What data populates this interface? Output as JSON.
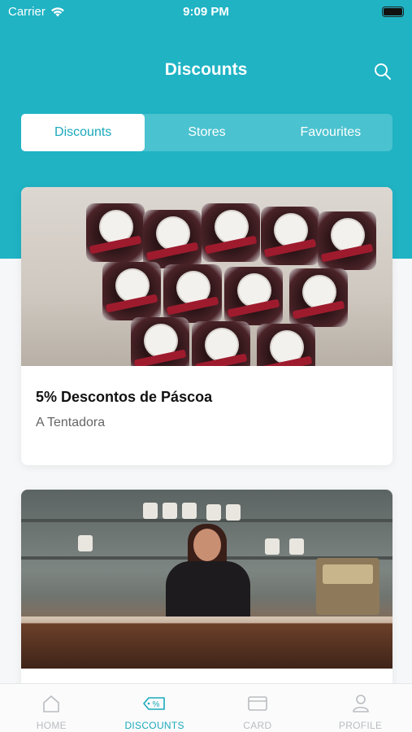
{
  "status_bar": {
    "carrier": "Carrier",
    "time": "9:09 PM"
  },
  "header": {
    "title": "Discounts",
    "search_icon": "search-icon"
  },
  "segments": [
    {
      "label": "Discounts",
      "active": true
    },
    {
      "label": "Stores",
      "active": false
    },
    {
      "label": "Favourites",
      "active": false
    }
  ],
  "cards": [
    {
      "title": "5% Descontos de Páscoa",
      "store": "A Tentadora",
      "image": "chocolate-gift-bags-photo"
    },
    {
      "title": "",
      "store": "",
      "image": "shop-counter-photo"
    }
  ],
  "tabbar": [
    {
      "label": "HOME",
      "icon": "home-icon",
      "active": false
    },
    {
      "label": "DISCOUNTS",
      "icon": "discount-tag-icon",
      "active": true
    },
    {
      "label": "CARD",
      "icon": "card-icon",
      "active": false
    },
    {
      "label": "PROFILE",
      "icon": "profile-icon",
      "active": false
    }
  ],
  "colors": {
    "accent": "#1fb3c4",
    "active_text": "#1aa9bb",
    "inactive_tab": "#b9bcc0"
  }
}
